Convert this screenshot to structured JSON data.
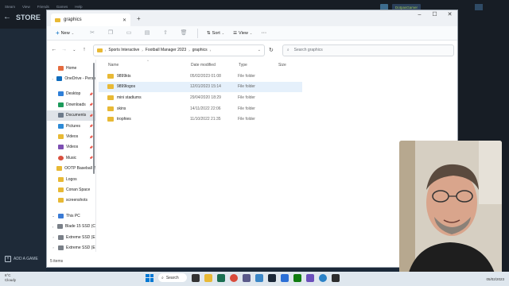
{
  "steam": {
    "menu": [
      "Steam",
      "View",
      "Friends",
      "Games",
      "Help"
    ],
    "store_label": "STORE",
    "user": "DotpasGamer",
    "add_game": "ADD A GAME"
  },
  "window": {
    "tab_title": "graphics",
    "new_tab": "+",
    "minimize": "–",
    "maximize": "☐",
    "close": "✕"
  },
  "toolbar": {
    "new_label": "New",
    "sort_label": "Sort",
    "view_label": "View",
    "more": "···"
  },
  "address": {
    "breadcrumb": [
      "Sports Interactive",
      "Football Manager 2023",
      "graphics"
    ],
    "search_placeholder": "Search graphics"
  },
  "sidebar": {
    "items": [
      {
        "label": "Home",
        "icon": "home-icon",
        "color": "#e46b3f",
        "expand": "",
        "pin": false,
        "selected": false
      },
      {
        "label": "OneDrive - Perso",
        "icon": "cloud-icon",
        "color": "#0f6cbd",
        "expand": "›",
        "pin": false,
        "selected": false
      },
      {
        "label": "Desktop",
        "icon": "desktop-icon",
        "color": "#2f7fd8",
        "expand": "",
        "pin": true,
        "selected": false
      },
      {
        "label": "Downloads",
        "icon": "download-icon",
        "color": "#1c9a5a",
        "expand": "",
        "pin": true,
        "selected": false
      },
      {
        "label": "Documents",
        "icon": "document-icon",
        "color": "#6d7a8a",
        "expand": "",
        "pin": true,
        "selected": true
      },
      {
        "label": "Pictures",
        "icon": "pictures-icon",
        "color": "#2d8ad6",
        "expand": "",
        "pin": true,
        "selected": false
      },
      {
        "label": "Videos",
        "icon": "folder-icon",
        "color": "#e8b935",
        "expand": "",
        "pin": true,
        "selected": false
      },
      {
        "label": "Videos",
        "icon": "video-icon",
        "color": "#7d4fb2",
        "expand": "",
        "pin": true,
        "selected": false
      },
      {
        "label": "Music",
        "icon": "music-icon",
        "color": "#d9503f",
        "expand": "",
        "pin": true,
        "selected": false
      },
      {
        "label": "OOTP Baseball 2",
        "icon": "folder-icon",
        "color": "#e8b935",
        "expand": "",
        "pin": false,
        "selected": false
      },
      {
        "label": "Logos",
        "icon": "folder-icon",
        "color": "#e8b935",
        "expand": "",
        "pin": false,
        "selected": false
      },
      {
        "label": "Conan Space",
        "icon": "folder-icon",
        "color": "#e8b935",
        "expand": "",
        "pin": false,
        "selected": false
      },
      {
        "label": "screenshots",
        "icon": "folder-icon",
        "color": "#e8b935",
        "expand": "",
        "pin": false,
        "selected": false
      }
    ],
    "drives": [
      {
        "label": "This PC",
        "icon": "pc-icon",
        "color": "#3a7bd5",
        "expand": "⌄"
      },
      {
        "label": "Blade 15 SSD (C",
        "icon": "drive-icon",
        "color": "#7a8088",
        "expand": "›"
      },
      {
        "label": "Extreme SSD (E",
        "icon": "drive-icon",
        "color": "#7a8088",
        "expand": "›"
      },
      {
        "label": "Extreme SSD (E",
        "icon": "drive-icon",
        "color": "#7a8088",
        "expand": "›"
      }
    ]
  },
  "columns": {
    "name": "Name",
    "date": "Date modified",
    "type": "Type",
    "size": "Size"
  },
  "files": [
    {
      "name": "9899kts",
      "date": "05/02/2023 01:08",
      "type": "File folder"
    },
    {
      "name": "9899logos",
      "date": "12/01/2023 15:14",
      "type": "File folder"
    },
    {
      "name": "mini stadiums",
      "date": "29/04/2020 18:29",
      "type": "File folder"
    },
    {
      "name": "skins",
      "date": "14/11/2022 22:06",
      "type": "File folder"
    },
    {
      "name": "trophies",
      "date": "11/10/2022 21:35",
      "type": "File folder"
    }
  ],
  "status": {
    "count": "5 items"
  },
  "taskbar": {
    "temp": "6°C",
    "weather": "Cloudy",
    "search": "Search",
    "date": "05/02/2023"
  }
}
